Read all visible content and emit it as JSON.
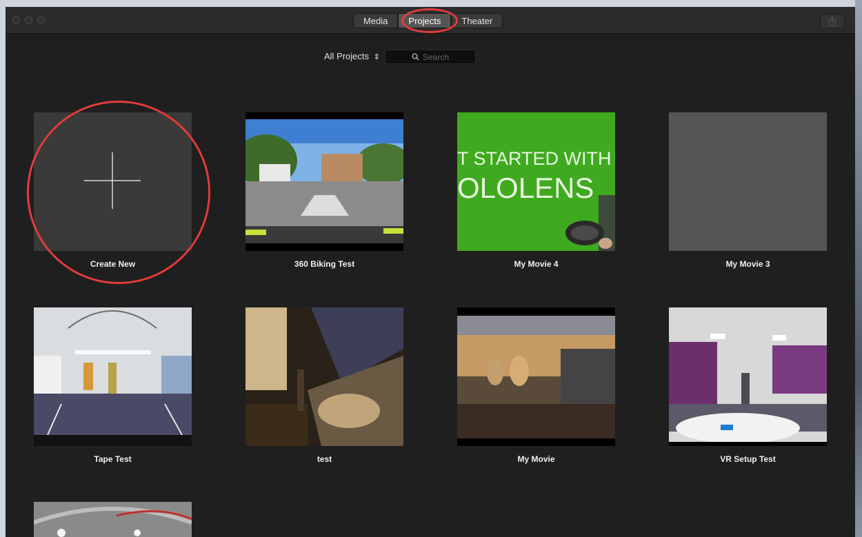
{
  "toolbar": {
    "tabs": [
      "Media",
      "Projects",
      "Theater"
    ],
    "active_tab": "Projects",
    "share_icon": "share-icon"
  },
  "filter": {
    "select_label": "All Projects",
    "search_placeholder": "Search"
  },
  "projects": [
    {
      "title": "Create New",
      "thumb": "plus-tile"
    },
    {
      "title": "360 Biking Test",
      "thumb": "street-panorama"
    },
    {
      "title": "My Movie 4",
      "thumb": "green-screen"
    },
    {
      "title": "My Movie 3",
      "thumb": "blank-gray"
    },
    {
      "title": "Tape Test",
      "thumb": "office-panorama"
    },
    {
      "title": "test",
      "thumb": "blurry-room"
    },
    {
      "title": "My Movie",
      "thumb": "guitar-room"
    },
    {
      "title": "VR Setup Test",
      "thumb": "purple-office"
    },
    {
      "title": "",
      "thumb": "partial-panorama"
    }
  ],
  "thumbnail_text": {
    "green_screen_line1": "T STARTED WITH",
    "green_screen_line2": "OLOLENS"
  },
  "colors": {
    "annotation_red": "#e23b3b",
    "window_bg": "#1f1f1f",
    "green_screen": "#3faa1f"
  }
}
